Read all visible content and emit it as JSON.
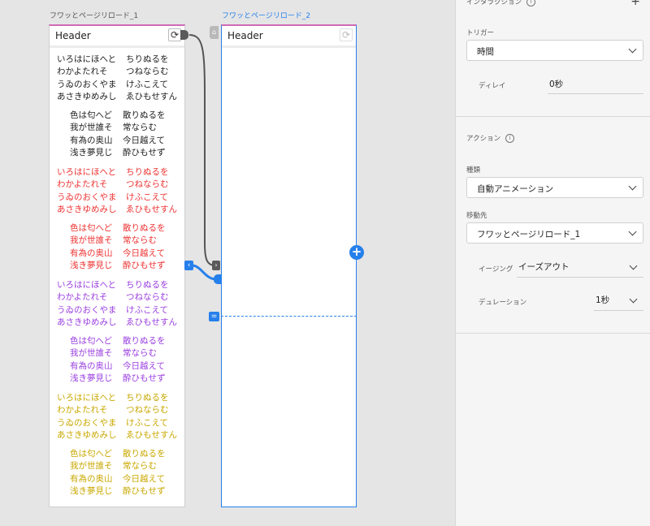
{
  "canvas": {
    "artboard1": {
      "title": "フワッとページリロード_1",
      "header": "Header",
      "poems": [
        {
          "color": "black",
          "style": "plain",
          "lines": [
            [
              "いろはにほへと",
              "ちりぬるを"
            ],
            [
              "わかよたれそ",
              "つねならむ"
            ],
            [
              "うゐのおくやま",
              "けふこえて"
            ],
            [
              "あさきゆめみし",
              "ゑひもせすん"
            ]
          ]
        },
        {
          "color": "black",
          "style": "indent",
          "lines": [
            [
              "色は匂へど",
              "散りぬるを"
            ],
            [
              "我が世誰そ",
              "常ならむ"
            ],
            [
              "有為の奥山",
              "今日越えて"
            ],
            [
              "浅き夢見じ",
              "酔ひもせず"
            ]
          ]
        },
        {
          "color": "red",
          "style": "plain",
          "lines": [
            [
              "いろはにほへと",
              "ちりぬるを"
            ],
            [
              "わかよたれそ",
              "つねならむ"
            ],
            [
              "うゐのおくやま",
              "けふこえて"
            ],
            [
              "あさきゆめみし",
              "ゑひもせすん"
            ]
          ]
        },
        {
          "color": "red",
          "style": "indent",
          "lines": [
            [
              "色は匂へど",
              "散りぬるを"
            ],
            [
              "我が世誰そ",
              "常ならむ"
            ],
            [
              "有為の奥山",
              "今日越えて"
            ],
            [
              "浅き夢見じ",
              "酔ひもせず"
            ]
          ]
        },
        {
          "color": "purple",
          "style": "plain",
          "lines": [
            [
              "いろはにほへと",
              "ちりぬるを"
            ],
            [
              "わかよたれそ",
              "つねならむ"
            ],
            [
              "うゐのおくやま",
              "けふこえて"
            ],
            [
              "あさきゆめみし",
              "ゑひもせすん"
            ]
          ]
        },
        {
          "color": "purple",
          "style": "indent",
          "lines": [
            [
              "色は匂へど",
              "散りぬるを"
            ],
            [
              "我が世誰そ",
              "常ならむ"
            ],
            [
              "有為の奥山",
              "今日越えて"
            ],
            [
              "浅き夢見じ",
              "酔ひもせず"
            ]
          ]
        },
        {
          "color": "yellow",
          "style": "plain",
          "lines": [
            [
              "いろはにほへと",
              "ちりぬるを"
            ],
            [
              "わかよたれそ",
              "つねならむ"
            ],
            [
              "うゐのおくやま",
              "けふこえて"
            ],
            [
              "あさきゆめみし",
              "ゑひもせすん"
            ]
          ]
        },
        {
          "color": "yellow",
          "style": "indent",
          "lines": [
            [
              "色は匂へど",
              "散りぬるを"
            ],
            [
              "我が世誰そ",
              "常ならむ"
            ],
            [
              "有為の奥山",
              "今日越えて"
            ],
            [
              "浅き夢見じ",
              "酔ひもせず"
            ]
          ]
        }
      ]
    },
    "artboard2": {
      "title": "フワッとページリロード_2",
      "header": "Header"
    },
    "colors": {
      "accent": "#2680eb",
      "red": "#ee3333",
      "purple": "#9a3fe0",
      "yellow": "#c9a800",
      "header_stripe": "#cf6bb4"
    },
    "icons": {
      "refresh": "refresh-icon",
      "home": "home-icon",
      "add": "add-icon",
      "scroll_handle": "scroll-handle-icon"
    }
  },
  "panel": {
    "interaction_title": "インタラクション",
    "add_label": "+",
    "trigger": {
      "label": "トリガー",
      "value": "時間"
    },
    "delay": {
      "label": "ディレイ",
      "value": "0秒"
    },
    "action_title": "アクション",
    "type": {
      "label": "種類",
      "value": "自動アニメーション"
    },
    "destination": {
      "label": "移動先",
      "value": "フワッとページリロード_1"
    },
    "easing": {
      "label": "イージング",
      "value": "イーズアウト"
    },
    "duration": {
      "label": "デュレーション",
      "value": "1秒"
    }
  }
}
